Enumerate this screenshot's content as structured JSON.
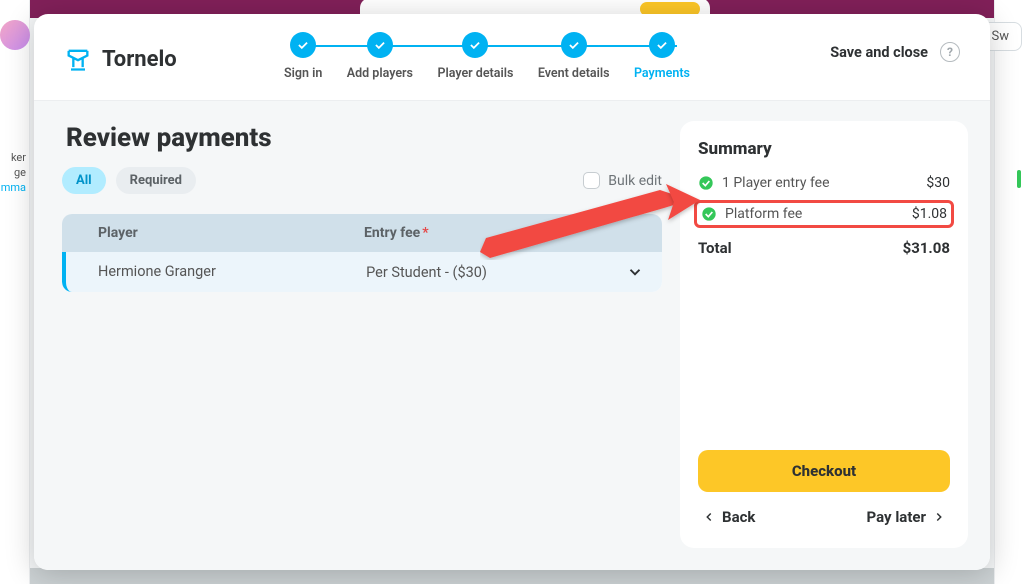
{
  "brand": {
    "name": "Tornelo"
  },
  "background": {
    "left_text": "ker\nge",
    "left_link": "mma",
    "right_btn": "Sw"
  },
  "steps": [
    {
      "label": "Sign in"
    },
    {
      "label": "Add players"
    },
    {
      "label": "Player details"
    },
    {
      "label": "Event details"
    },
    {
      "label": "Payments",
      "active": true
    }
  ],
  "header": {
    "save_close": "Save and close",
    "help": "?"
  },
  "page": {
    "title": "Review payments",
    "filters": {
      "all": "All",
      "required": "Required"
    },
    "bulk_edit": "Bulk edit",
    "table": {
      "col_player": "Player",
      "col_fee": "Entry fee",
      "rows": [
        {
          "player": "Hermione Granger",
          "fee": "Per Student - ($30)"
        }
      ]
    }
  },
  "summary": {
    "title": "Summary",
    "lines": [
      {
        "label": "1 Player entry fee",
        "amount": "$30"
      },
      {
        "label": "Platform fee",
        "amount": "$1.08",
        "highlight": true
      }
    ],
    "total_label": "Total",
    "total_amount": "$31.08",
    "checkout": "Checkout",
    "back": "Back",
    "pay_later": "Pay later"
  }
}
